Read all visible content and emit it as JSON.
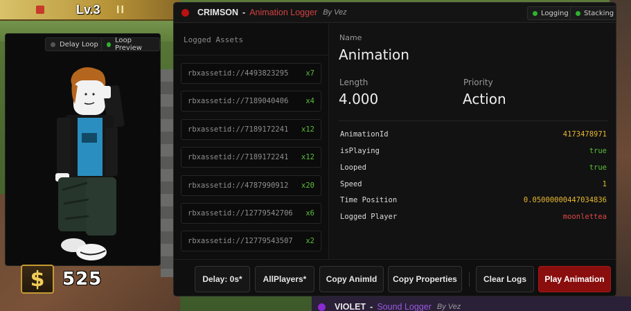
{
  "game": {
    "level_label": "Lv.3",
    "pause_glyph": "II",
    "cash_symbol": "$",
    "cash_amount": "525"
  },
  "preview": {
    "delay_loop_label": "Delay Loop",
    "loop_preview_label": "Loop Preview",
    "delay_loop_color": "#555555",
    "loop_preview_color": "#2fb32f"
  },
  "window": {
    "app": "CRIMSON",
    "separator": "-",
    "module": "Animation Logger",
    "author": "By Vez",
    "status_color": "#bb1111",
    "tags": [
      {
        "label": "Logging",
        "color": "#2fb32f"
      },
      {
        "label": "Stacking",
        "color": "#2fb32f"
      }
    ]
  },
  "logged": {
    "header": "Logged Assets",
    "items": [
      {
        "id": "rbxassetid://4493823295",
        "count": "x7"
      },
      {
        "id": "rbxassetid://7189040406",
        "count": "x4"
      },
      {
        "id": "rbxassetid://7189172241",
        "count": "x12"
      },
      {
        "id": "rbxassetid://7189172241",
        "count": "x12"
      },
      {
        "id": "rbxassetid://4787990912",
        "count": "x20"
      },
      {
        "id": "rbxassetid://12779542706",
        "count": "x6"
      },
      {
        "id": "rbxassetid://12779543507",
        "count": "x2"
      }
    ]
  },
  "details": {
    "name_label": "Name",
    "name_value": "Animation",
    "length_label": "Length",
    "length_value": "4.000",
    "priority_label": "Priority",
    "priority_value": "Action",
    "props": [
      {
        "key": "AnimationId",
        "value": "4173478971",
        "color": "#e8b830"
      },
      {
        "key": "isPlaying",
        "value": "true",
        "color": "#5bbf3a"
      },
      {
        "key": "Looped",
        "value": "true",
        "color": "#5bbf3a"
      },
      {
        "key": "Speed",
        "value": "1",
        "color": "#e8b830"
      },
      {
        "key": "Time Position",
        "value": "0.05000000447034836",
        "color": "#e8b830"
      },
      {
        "key": "Logged Player",
        "value": "moonlettea",
        "color": "#e04848"
      }
    ]
  },
  "footer": {
    "delay": "Delay: 0s*",
    "players": "AllPlayers*",
    "copy_animid": "Copy AnimId",
    "copy_props": "Copy Properties",
    "clear": "Clear Logs",
    "play": "Play Animation"
  },
  "violet": {
    "app": "VIOLET",
    "separator": "-",
    "module": "Sound Logger",
    "author": "By Vez"
  }
}
